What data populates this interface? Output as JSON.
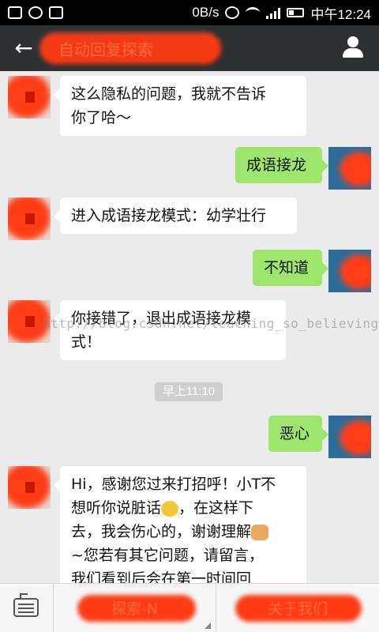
{
  "status_bar": {
    "net_speed": "0B/s",
    "time": "中午12:24"
  },
  "title_bar": {
    "title": "自动回复探索"
  },
  "messages": [
    {
      "from": "bot",
      "lines": [
        "这么隐私的问题，我就不告诉",
        "你了哈～"
      ]
    },
    {
      "from": "me",
      "text": "成语接龙"
    },
    {
      "from": "bot",
      "lines": [
        "进入成语接龙模式：幼学壮行"
      ]
    },
    {
      "from": "me",
      "text": "不知道"
    },
    {
      "from": "bot",
      "lines": [
        "你接错了，退出成语接龙模",
        "式！"
      ]
    },
    {
      "from": "me",
      "text": "恶心"
    },
    {
      "from": "bot",
      "lines": [
        "Hi，感谢您过来打招呼！小T不",
        "想听你说脏话",
        "，在这样下",
        "去，我会伤心的，谢谢理解",
        "~您若有其它问题，请留言，",
        "我们看到后会在第一时间回"
      ]
    }
  ],
  "timestamp": "早上11:10",
  "watermark": "http://blog.csdn.net/teaching_so_believing",
  "bottom_bar": {
    "menu_1": "探索-N",
    "menu_2": "关于我们"
  },
  "icons": {
    "back": "back-arrow-icon",
    "profile": "profile-icon",
    "keyboard": "keyboard-icon"
  }
}
